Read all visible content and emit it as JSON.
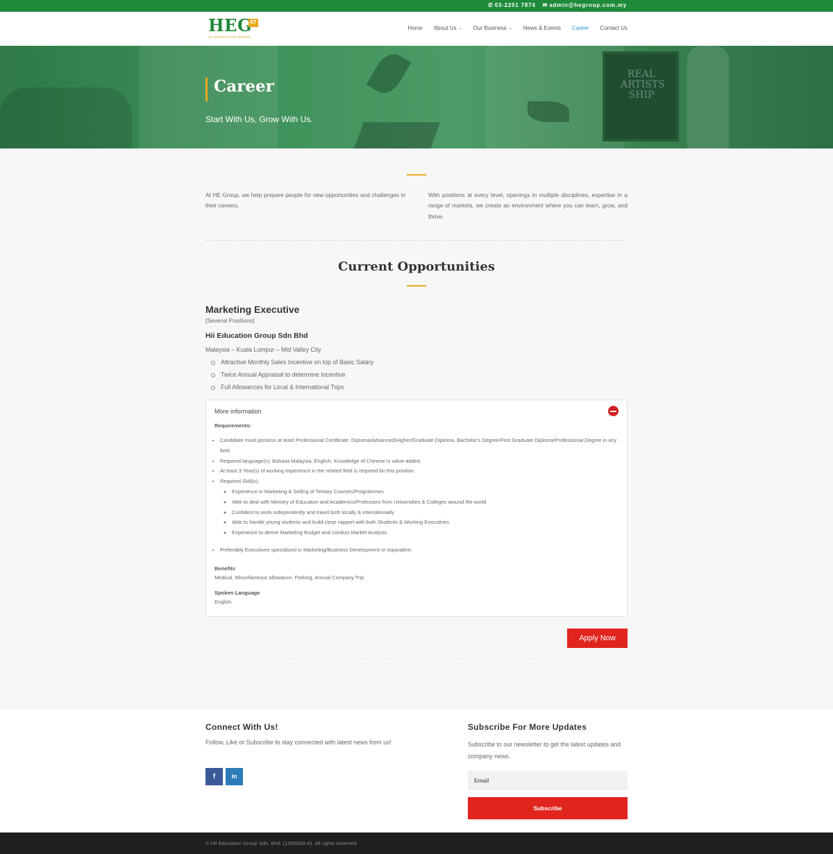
{
  "topbar": {
    "phone": "03-2201 7874",
    "email": "admin@hegroup.com.my",
    "color": "#1e8a3a"
  },
  "logo": {
    "main": "HEG",
    "badge": "ET",
    "sub": "HII EDUCATION GROUP"
  },
  "nav": {
    "items": [
      {
        "label": "Home"
      },
      {
        "label": "About Us",
        "dropdown": true
      },
      {
        "label": "Our Business",
        "dropdown": true
      },
      {
        "label": "News & Events"
      },
      {
        "label": "Career",
        "active": true
      },
      {
        "label": "Contact Us"
      }
    ],
    "active_color": "#2e9bd6"
  },
  "hero": {
    "title": "Career",
    "tagline": "Start With Us, Grow With Us.",
    "poster_text": "REAL ARTISTS SHIP"
  },
  "intro": {
    "left": "At HE Group, we help prepare people for new opportunities and challenges in their careers.",
    "right": "With positions at every level, openings in multiple disciplines, expertise in a range of markets, we create an environment where you can learn, grow, and thrive."
  },
  "opportunities": {
    "title": "Current Opportunities"
  },
  "job": {
    "title": "Marketing Executive",
    "positions": "[Several Positions]",
    "company": "Hii Education Group Sdn Bhd",
    "location": "Malaysia – Kuala Lumpur – Mid Valley City",
    "perks": [
      "Attractive Monthly Sales Incentive on top of Basic Salary",
      "Twice Annual Appraisal to determine Incentive",
      "Full Allowances for Local & International Trips"
    ],
    "more_info_label": "More information",
    "requirements_label": "Requirements:",
    "requirements": [
      "Candidate must possess at least Professional Certificate, Diploma/Advanced/Higher/Graduate Diploma, Bachelor's Degree/Post Graduate Diploma/Professional Degree in any field.",
      "Required language(s): Bahasa Malaysia, English. Knowledge of Chinese is value-added.",
      "At least 3 Year(s) of working experience in the related field is required for this position.",
      "Required Skill(s):"
    ],
    "skills": [
      "Experience in Marketing & Selling of Tertiary Courses/Programmes",
      "Able to deal with Ministry of Education and Academics/Professors from Universities & Colleges around the world",
      "Confident to work independently and travel both locally & internationally",
      "Able to handle young students and build close rapport with both Students & Working Executives",
      " Experience to derive Marketing Budget and conduct Market Analysis"
    ],
    "preferred": "Preferably Executives specialized in Marketing/Business Development or equivalent.",
    "benefits_label": "Benefits",
    "benefits": "Medical, Miscellaneous allowance, Parking, Annual Company Trip",
    "language_label": "Spoken Language",
    "language": "English",
    "apply_label": "Apply Now"
  },
  "footer": {
    "connect_title": "Connect With Us!",
    "connect_text": "Follow, Like or Subscribe to stay connected with latest news from us!",
    "social": [
      {
        "label": "f",
        "icon": "facebook-icon",
        "color": "#3b5998"
      },
      {
        "label": "in",
        "icon": "linkedin-icon",
        "color": "#2a7bb8"
      }
    ],
    "subscribe_title": "Subscribe For More Updates",
    "subscribe_text": "Subscribe to our newsletter to get the latest updates and company news.",
    "email_placeholder": "Email",
    "subscribe_label": "Subscribe",
    "copyright": "© Hii Education Group Sdn. Bhd. (1285063-A). All rights reserved."
  },
  "colors": {
    "accent_gold": "#e8a91f",
    "button_red": "#e0241e"
  }
}
